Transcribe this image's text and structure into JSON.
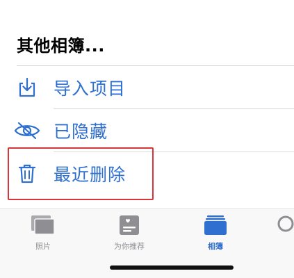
{
  "section": {
    "title": "其他相簿..."
  },
  "items": [
    {
      "label": "导入项目",
      "icon": "import-icon"
    },
    {
      "label": "已隐藏",
      "icon": "hidden-eye-icon"
    },
    {
      "label": "最近删除",
      "icon": "trash-icon"
    }
  ],
  "tabbar": {
    "tabs": [
      {
        "label": "照片",
        "icon": "photos-icon",
        "active": false
      },
      {
        "label": "为你推荐",
        "icon": "for-you-icon",
        "active": false
      },
      {
        "label": "相簿",
        "icon": "albums-icon",
        "active": true
      }
    ]
  },
  "colors": {
    "accent": "#2e6fcf",
    "highlight": "#d6363a",
    "inactive": "#8e8e93"
  }
}
